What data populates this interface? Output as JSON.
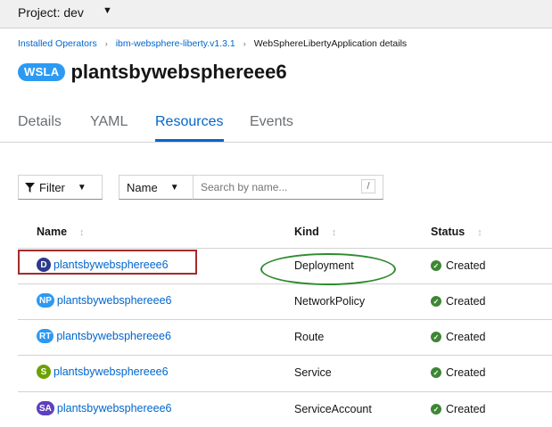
{
  "project_bar": {
    "label": "Project: dev",
    "caret": "▼"
  },
  "breadcrumb": {
    "items": [
      "Installed Operators",
      "ibm-websphere-liberty.v1.3.1",
      "WebSphereLibertyApplication details"
    ],
    "separator": "›"
  },
  "header": {
    "badge": "WSLA",
    "title": "plantsbywebsphereee6"
  },
  "tabs": [
    "Details",
    "YAML",
    "Resources",
    "Events"
  ],
  "active_tab": "Resources",
  "toolbar": {
    "filter_label": "Filter",
    "name_select": "Name",
    "search_placeholder": "Search by name...",
    "search_shortcut": "/"
  },
  "table": {
    "columns": [
      "Name",
      "Kind",
      "Status"
    ],
    "rows": [
      {
        "badge": "D",
        "badge_color": "#2d3a8c",
        "name": "plantsbywebsphereee6",
        "kind": "Deployment",
        "status": "Created"
      },
      {
        "badge": "NP",
        "badge_color": "#2b9af3",
        "name": "plantsbywebsphereee6",
        "kind": "NetworkPolicy",
        "status": "Created"
      },
      {
        "badge": "RT",
        "badge_color": "#2b9af3",
        "name": "plantsbywebsphereee6",
        "kind": "Route",
        "status": "Created"
      },
      {
        "badge": "S",
        "badge_color": "#6ca100",
        "name": "plantsbywebsphereee6",
        "kind": "Service",
        "status": "Created"
      },
      {
        "badge": "SA",
        "badge_color": "#5e40be",
        "name": "plantsbywebsphereee6",
        "kind": "ServiceAccount",
        "status": "Created"
      }
    ]
  },
  "colors": {
    "link": "#0066cc",
    "status_ok": "#3e8635",
    "highlight_box": "#a52a2a",
    "highlight_ellipse": "#2e8b2e"
  }
}
